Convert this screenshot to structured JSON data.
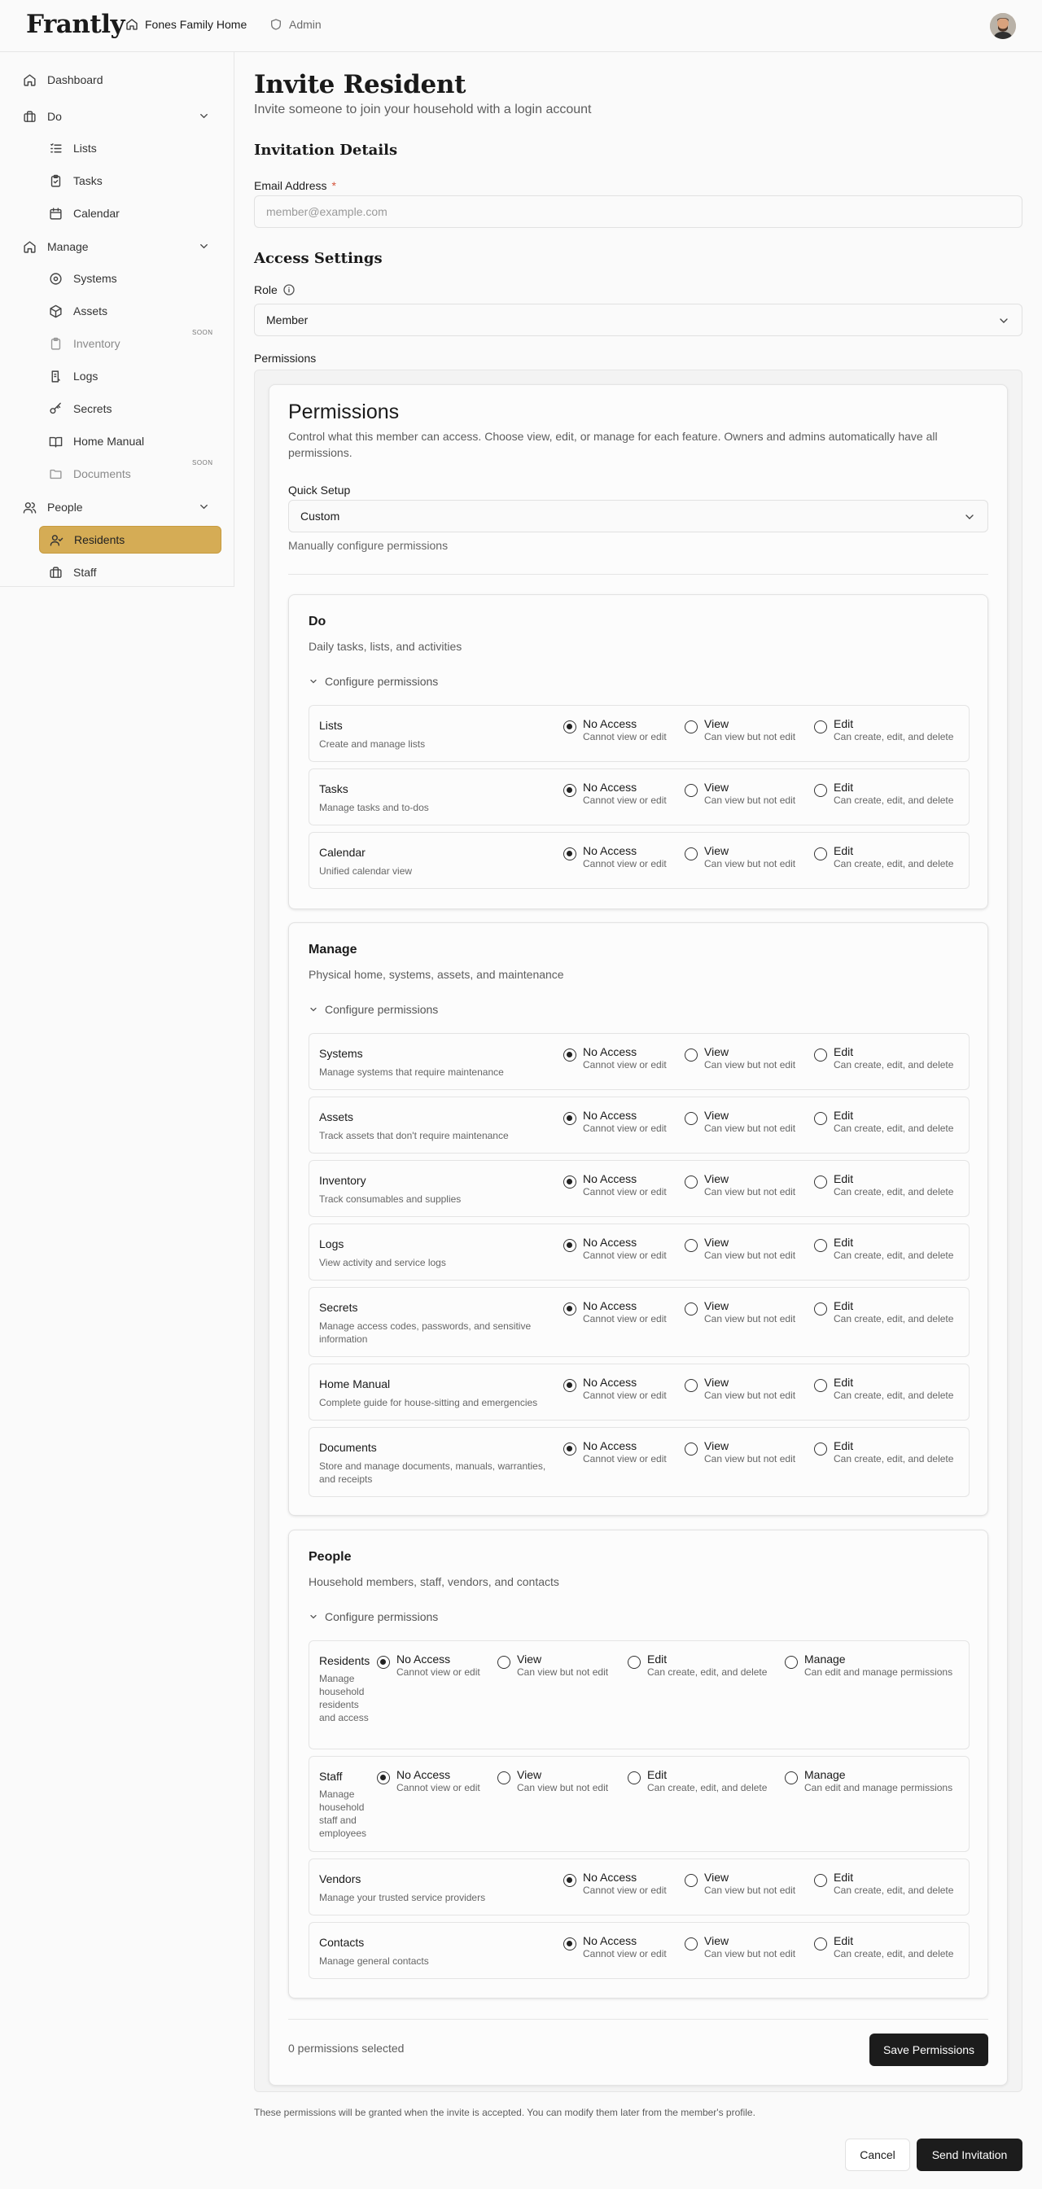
{
  "brand": "Frantly",
  "header": {
    "household": "Fones Family Home",
    "admin": "Admin"
  },
  "sidebar": {
    "items": [
      {
        "label": "Dashboard",
        "icon": "home-icon"
      },
      {
        "label": "Do",
        "icon": "briefcase-icon"
      },
      {
        "label": "Lists",
        "icon": "list-icon"
      },
      {
        "label": "Tasks",
        "icon": "clipboard-icon"
      },
      {
        "label": "Calendar",
        "icon": "calendar-icon"
      },
      {
        "label": "Manage",
        "icon": "home-icon"
      },
      {
        "label": "Systems",
        "icon": "cog-icon"
      },
      {
        "label": "Assets",
        "icon": "box-icon"
      },
      {
        "label": "Inventory",
        "icon": "clipboard-icon",
        "badge": "SOON"
      },
      {
        "label": "Logs",
        "icon": "log-icon"
      },
      {
        "label": "Secrets",
        "icon": "key-icon"
      },
      {
        "label": "Home Manual",
        "icon": "book-icon"
      },
      {
        "label": "Documents",
        "icon": "folder-icon",
        "badge": "SOON"
      },
      {
        "label": "People",
        "icon": "users-icon"
      },
      {
        "label": "Residents",
        "icon": "user-check-icon"
      },
      {
        "label": "Staff",
        "icon": "briefcase-icon"
      }
    ],
    "active": "Residents",
    "active_color": "#d5ac55"
  },
  "page": {
    "title": "Invite Resident",
    "subtitle": "Invite someone to join your household with a login account",
    "invitation_heading": "Invitation Details",
    "email_label": "Email Address",
    "email_required": "*",
    "email_placeholder": "member@example.com",
    "access_heading": "Access Settings",
    "role_label": "Role",
    "role_value": "Member",
    "permissions_label": "Permissions",
    "footer_note": "These permissions will be granted when the invite is accepted. You can modify them later from the member's profile.",
    "cancel": "Cancel",
    "send": "Send Invitation"
  },
  "permissions": {
    "title": "Permissions",
    "description": "Control what this member can access. Choose view, edit, or manage for each feature. Owners and admins automatically have all permissions.",
    "quick_setup_label": "Quick Setup",
    "quick_setup_value": "Custom",
    "quick_setup_note": "Manually configure permissions",
    "count_text": "0 permissions selected",
    "save": "Save Permissions",
    "configure": "Configure permissions",
    "options": {
      "none": {
        "label": "No Access",
        "sub": "Cannot view or edit"
      },
      "view": {
        "label": "View",
        "sub": "Can view but not edit"
      },
      "edit": {
        "label": "Edit",
        "sub": "Can create, edit, and delete"
      },
      "manage": {
        "label": "Manage",
        "sub": "Can edit and manage permissions"
      }
    },
    "groups": [
      {
        "title": "Do",
        "desc": "Daily tasks, lists, and activities",
        "rows": [
          {
            "name": "Lists",
            "desc": "Create and manage lists"
          },
          {
            "name": "Tasks",
            "desc": "Manage tasks and to-dos"
          },
          {
            "name": "Calendar",
            "desc": "Unified calendar view"
          }
        ]
      },
      {
        "title": "Manage",
        "desc": "Physical home, systems, assets, and maintenance",
        "rows": [
          {
            "name": "Systems",
            "desc": "Manage systems that require maintenance"
          },
          {
            "name": "Assets",
            "desc": "Track assets that don't require maintenance"
          },
          {
            "name": "Inventory",
            "desc": "Track consumables and supplies"
          },
          {
            "name": "Logs",
            "desc": "View activity and service logs"
          },
          {
            "name": "Secrets",
            "desc": "Manage access codes, passwords, and sensitive information"
          },
          {
            "name": "Home Manual",
            "desc": "Complete guide for house-sitting and emergencies"
          },
          {
            "name": "Documents",
            "desc": "Store and manage documents, manuals, warranties, and receipts"
          }
        ]
      },
      {
        "title": "People",
        "desc": "Household members, staff, vendors, and contacts",
        "rows": [
          {
            "name": "Residents",
            "desc": "Manage household residents and access"
          },
          {
            "name": "Staff",
            "desc": "Manage household staff and employees"
          },
          {
            "name": "Vendors",
            "desc": "Manage your trusted service providers"
          },
          {
            "name": "Contacts",
            "desc": "Manage general contacts"
          }
        ]
      }
    ]
  }
}
